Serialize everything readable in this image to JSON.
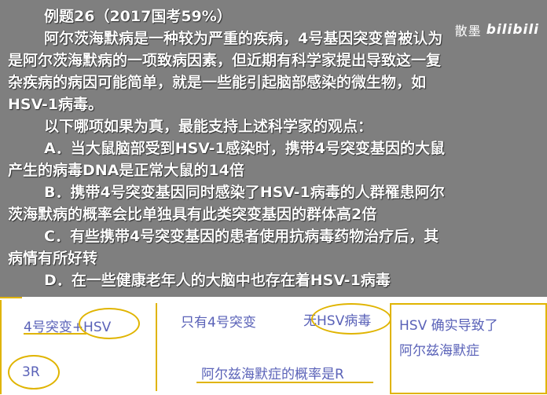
{
  "watermark": {
    "text": "散墨",
    "brand": "bilibili"
  },
  "question": {
    "title": "例题26（2017国考59%）",
    "lines": [
      "阿尔茨海默病是一种较为严重的疾病，4号基因突变曾被认为",
      "是阿尔茨海默病的一项致病因素，但近期有科学家提出导致这一复",
      "杂疾病的病因可能简单，就是一些能引起脑部感染的微生物，如",
      "HSV-1病毒。",
      "以下哪项如果为真，最能支持上述科学家的观点：",
      "A．当大鼠脑部受到HSV-1感染时，携带4号突变基因的大鼠",
      "产生的病毒DNA是正常大鼠的14倍",
      "B．携带4号突变基因同时感染了HSV-1病毒的人群罹患阿尔",
      "茨海默病的概率会比单独具有此类突变基因的群体高2倍",
      "C．有些携带4号突变基因的患者使用抗病毒药物治疗后，其",
      "病情有所好转",
      "D．在一些健康老年人的大脑中也存在着HSV-1病毒"
    ]
  },
  "notes": {
    "n1": "4号突变+HSV",
    "n2": "只有4号突变",
    "n3": "无HSV病毒",
    "n4_line1": "HSV 确实导致了",
    "n4_line2": "阿尔兹海默症",
    "n5": "3R",
    "n6": "阿尔兹海默症的概率是R"
  },
  "colors": {
    "ink": "#5a62b8",
    "marker": "#e0b400",
    "text": "#ffffff",
    "background": "#7f7f7f"
  }
}
